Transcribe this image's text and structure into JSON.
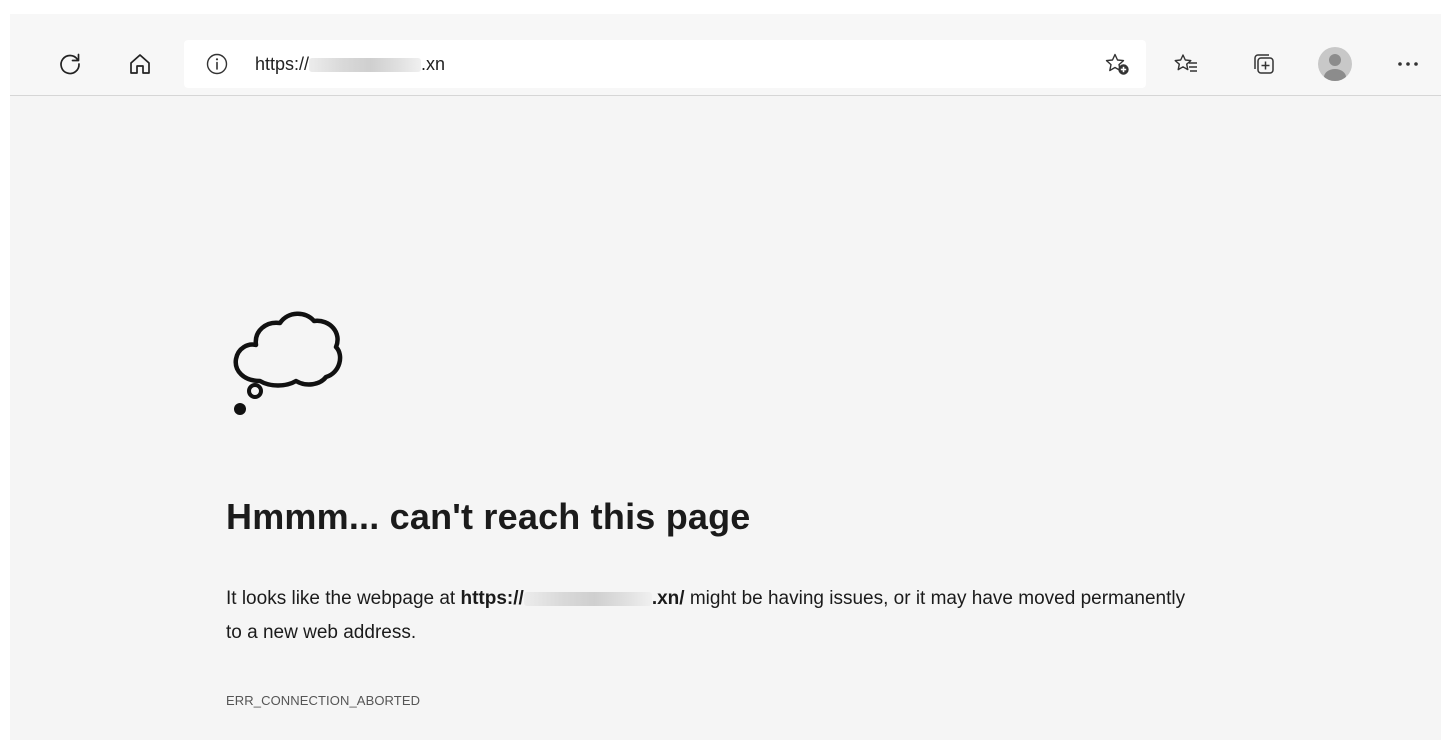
{
  "toolbar": {
    "url_scheme": "https://",
    "url_tld": ".xn",
    "icons": [
      "refresh-icon",
      "home-icon",
      "info-icon",
      "add-favorite-icon",
      "favorites-icon",
      "collections-icon",
      "profile-avatar",
      "more-icon"
    ]
  },
  "error_page": {
    "icon": "thought-cloud-icon",
    "heading": "Hmmm... can't reach this page",
    "message_before": "It looks like the webpage at ",
    "message_url_scheme": "https://",
    "message_url_tld": ".xn/",
    "message_after": " might be having issues, or it may have moved permanently to a new web address.",
    "error_code": "ERR_CONNECTION_ABORTED"
  }
}
